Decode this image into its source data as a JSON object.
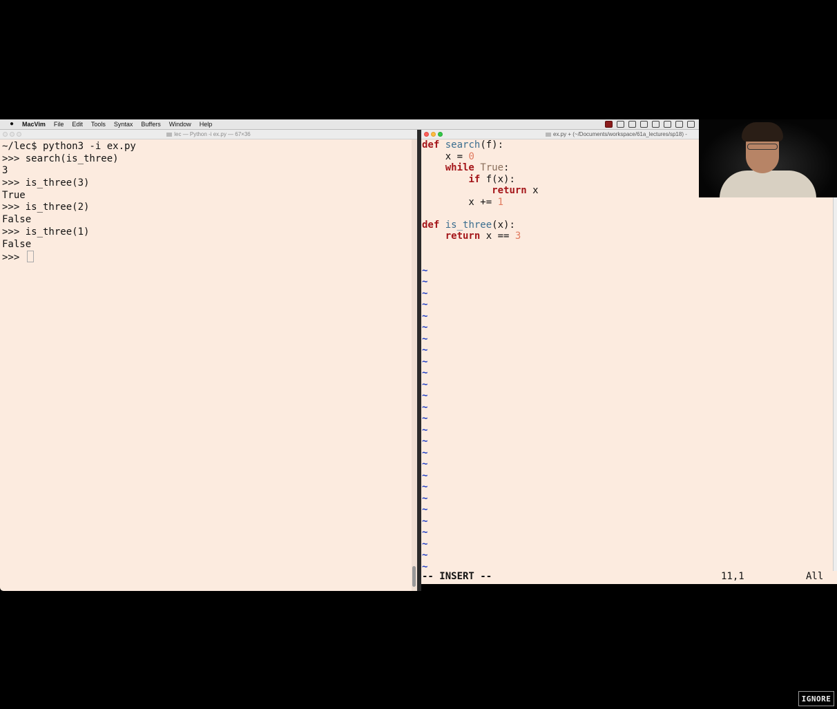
{
  "menubar": {
    "app_name": "MacVim",
    "items": [
      "File",
      "Edit",
      "Tools",
      "Syntax",
      "Buffers",
      "Window",
      "Help"
    ]
  },
  "terminal": {
    "title": "lec — Python -i ex.py — 67×36",
    "lines": [
      "~/lec$ python3 -i ex.py",
      ">>> search(is_three)",
      "3",
      ">>> is_three(3)",
      "True",
      ">>> is_three(2)",
      "False",
      ">>> is_three(1)",
      "False"
    ],
    "prompt": ">>> "
  },
  "vim": {
    "title": "ex.py + (~/Documents/workspace/61a_lectures/sp18) -",
    "code": {
      "l1_kw": "def",
      "l1_fn": "search",
      "l1_rest": "(f):",
      "l2_a": "    x = ",
      "l2_num": "0",
      "l3_ind": "    ",
      "l3_kw": "while",
      "l3_const": "True",
      "l3_rest": ":",
      "l4_ind": "        ",
      "l4_kw": "if",
      "l4_rest": " f(x):",
      "l5_ind": "            ",
      "l5_kw": "return",
      "l5_rest": " x",
      "l6_a": "        x += ",
      "l6_num": "1",
      "l8_kw": "def",
      "l8_fn": "is_three",
      "l8_rest": "(x):",
      "l9_ind": "    ",
      "l9_kw": "return",
      "l9_rest": " x == ",
      "l9_num": "3"
    },
    "tilde": "~",
    "status": {
      "mode": "-- INSERT --",
      "position": "11,1",
      "scroll": "All"
    }
  },
  "overlay": {
    "ignore_label": "IGNORE"
  }
}
